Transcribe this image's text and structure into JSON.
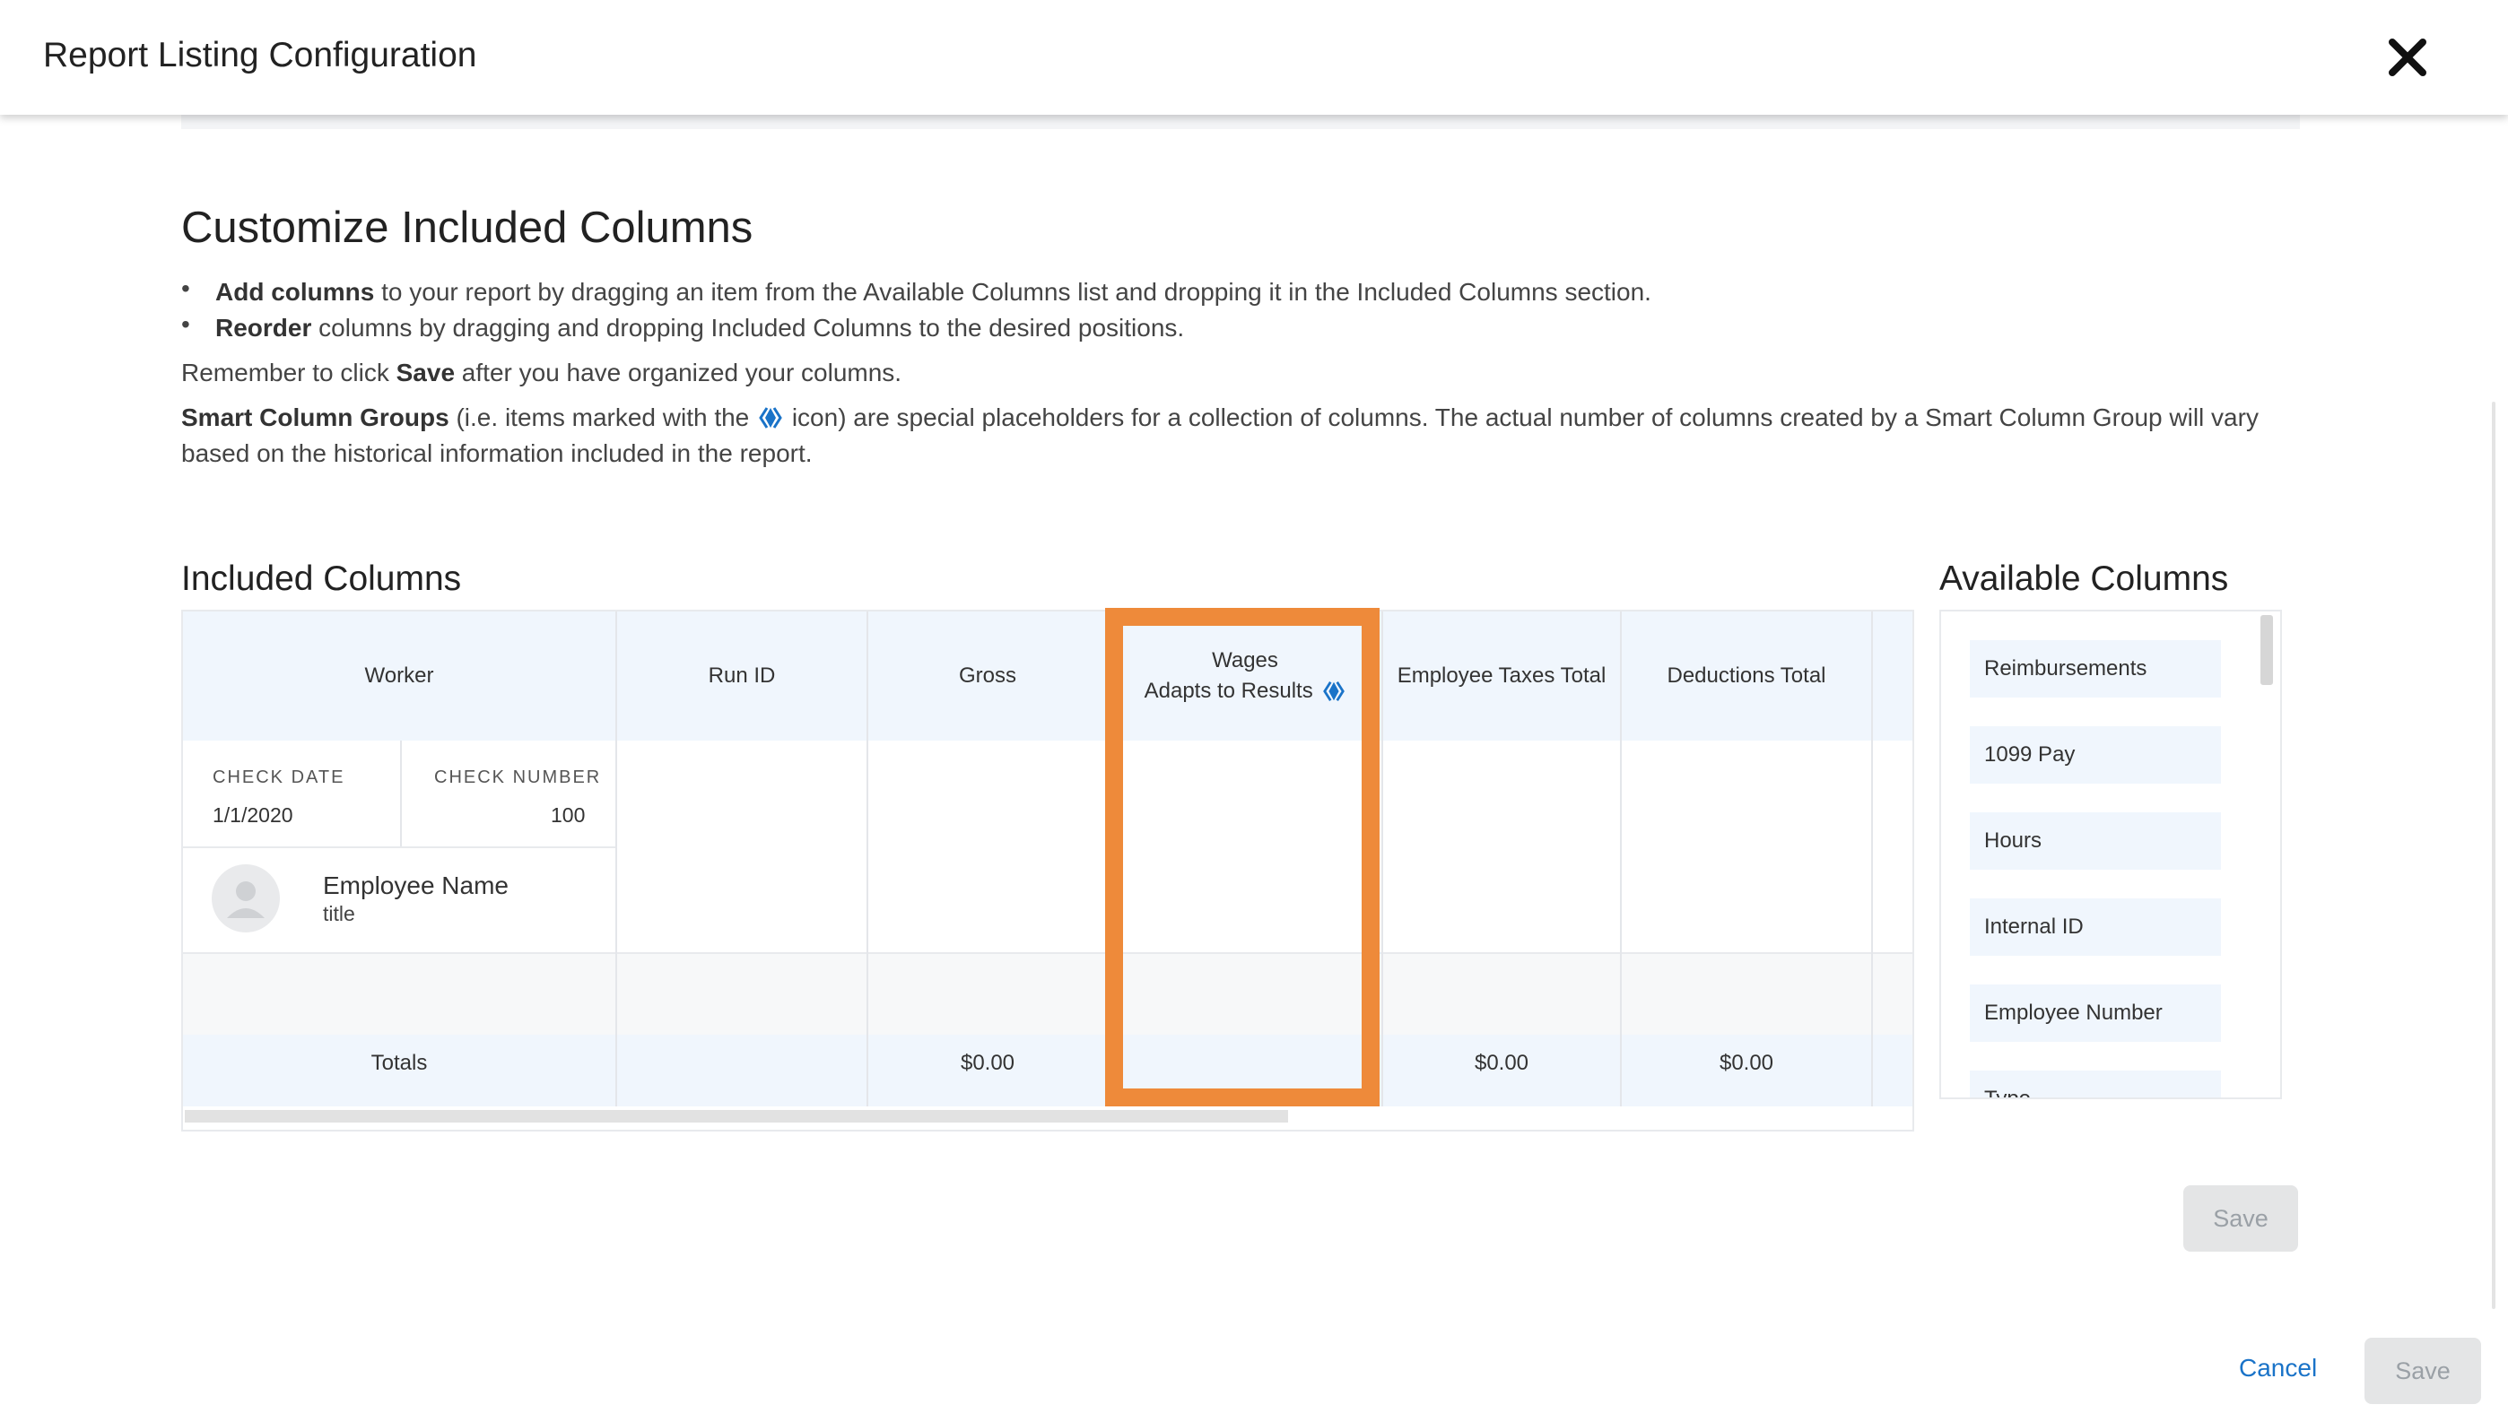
{
  "header": {
    "title": "Report Listing Configuration"
  },
  "intro": {
    "heading": "Customize Included Columns",
    "bullet1_bold": "Add columns",
    "bullet1_rest": " to your report by dragging an item from the Available Columns list and dropping it in the Included Columns section.",
    "bullet2_bold": "Reorder",
    "bullet2_rest": " columns by dragging and dropping Included Columns to the desired positions.",
    "remember_pre": "Remember to click ",
    "remember_bold": "Save",
    "remember_post": " after you have organized your columns.",
    "smart_bold": "Smart Column Groups",
    "smart_pre": " (i.e. items marked with the ",
    "smart_post": " icon) are special placeholders for a collection of columns. The actual number of columns created by a Smart Column Group will vary",
    "smart_line2": "based on the historical information included in the report."
  },
  "included": {
    "heading": "Included Columns",
    "columns": [
      "Worker",
      "Run ID",
      "Gross",
      "Wages",
      "Employee Taxes Total",
      "Deductions Total"
    ],
    "wages_subtitle": "Adapts to Results",
    "worker_card": {
      "check_date_label": "CHECK DATE",
      "check_date_value": "1/1/2020",
      "check_number_label": "CHECK NUMBER",
      "check_number_value": "100",
      "employee_name": "Employee Name",
      "employee_title": "title"
    },
    "totals": {
      "label": "Totals",
      "gross": "$0.00",
      "employee_taxes_total": "$0.00",
      "deductions_total": "$0.00"
    }
  },
  "available": {
    "heading": "Available Columns",
    "items": [
      "Reimbursements",
      "1099 Pay",
      "Hours",
      "Internal ID",
      "Employee Number",
      "Type"
    ]
  },
  "buttons": {
    "save": "Save",
    "cancel": "Cancel",
    "footer_save": "Save"
  },
  "colors": {
    "accent_blue": "#1a73c8",
    "highlight_orange": "#ee8a3a",
    "header_fill": "#f0f6fd"
  }
}
